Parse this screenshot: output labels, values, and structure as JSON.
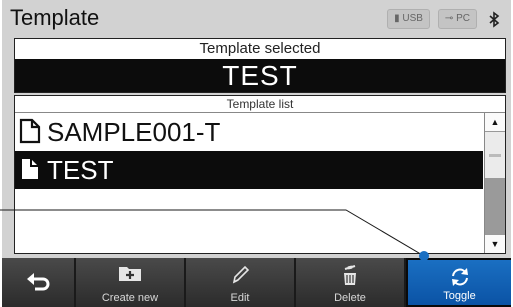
{
  "header": {
    "title": "Template",
    "status": {
      "usb_label": "USB",
      "pc_label": "PC"
    }
  },
  "selected": {
    "label": "Template selected",
    "value": "TEST"
  },
  "template_list": {
    "label": "Template list",
    "items": [
      {
        "name": "SAMPLE001-T",
        "selected": false
      },
      {
        "name": "TEST",
        "selected": true
      }
    ]
  },
  "toolbar": {
    "create_label": "Create new",
    "edit_label": "Edit",
    "delete_label": "Delete",
    "toggle_label": "Toggle"
  },
  "colors": {
    "accent": "#1a6fc2",
    "selected_bg": "#0c0c0c",
    "toolbar_bg": "#3a3a3a"
  }
}
